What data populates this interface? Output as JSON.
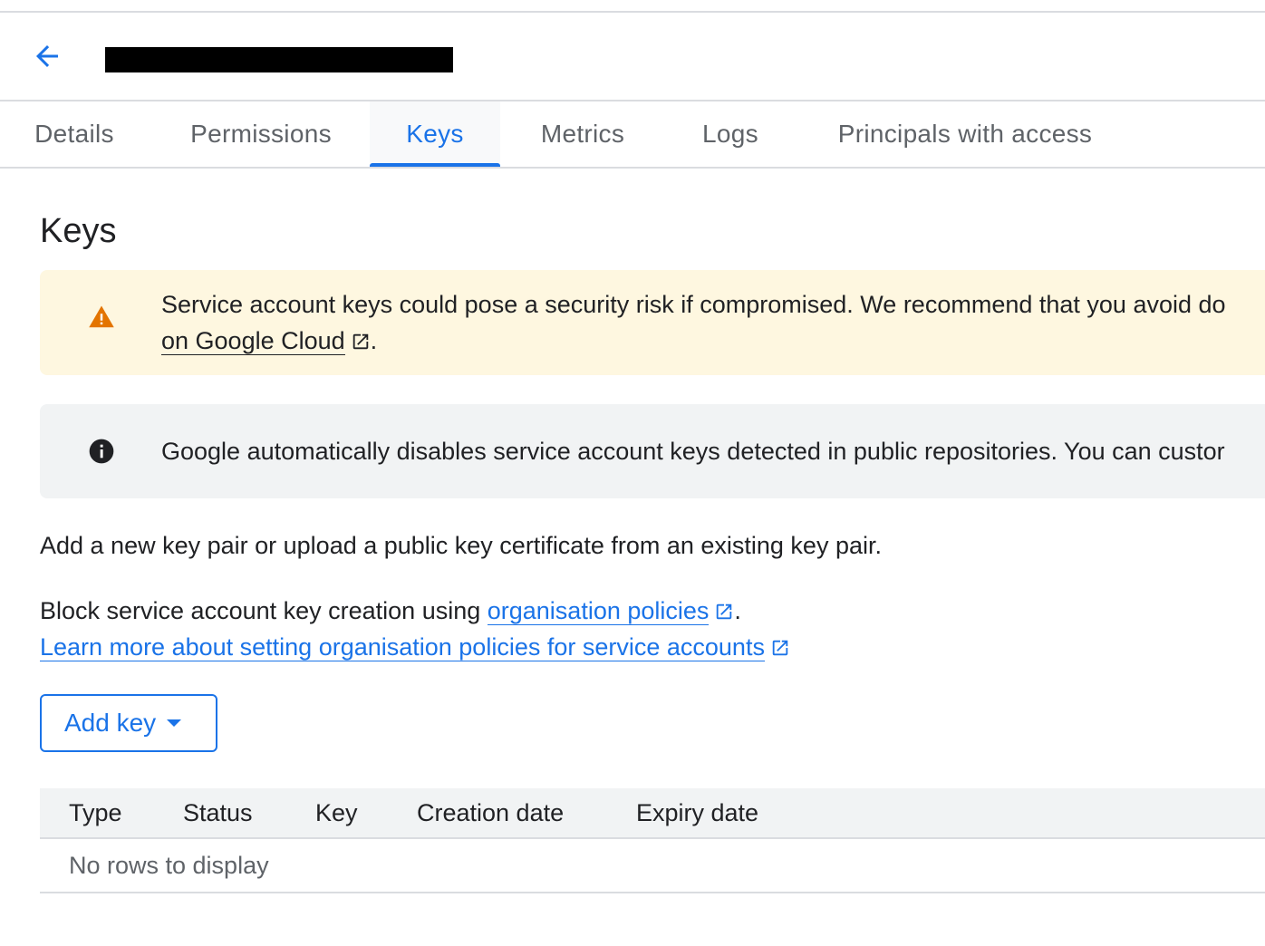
{
  "header": {
    "back_icon": "arrow-back-icon",
    "title_redacted": true
  },
  "tabs": [
    {
      "label": "Details",
      "active": false
    },
    {
      "label": "Permissions",
      "active": false
    },
    {
      "label": "Keys",
      "active": true
    },
    {
      "label": "Metrics",
      "active": false
    },
    {
      "label": "Logs",
      "active": false
    },
    {
      "label": "Principals with access",
      "active": false
    }
  ],
  "page": {
    "title": "Keys"
  },
  "warning_banner": {
    "icon": "warning-icon",
    "line1": "Service account keys could pose a security risk if compromised. We recommend that you avoid do",
    "link_text": "on Google Cloud",
    "link_suffix": "."
  },
  "info_banner": {
    "icon": "info-icon",
    "text": "Google automatically disables service account keys detected in public repositories. You can custor"
  },
  "intro": {
    "text": "Add a new key pair or upload a public key certificate from an existing key pair."
  },
  "policy": {
    "prefix": "Block service account key creation using ",
    "link_text": "organisation policies",
    "suffix": ".",
    "learn_more": "Learn more about setting organisation policies for service accounts"
  },
  "add_key_button": {
    "label": "Add key"
  },
  "table": {
    "columns": [
      "Type",
      "Status",
      "Key",
      "Creation date",
      "Expiry date"
    ],
    "empty_message": "No rows to display"
  },
  "colors": {
    "accent": "#1a73e8",
    "warning_bg": "#fef7e0",
    "warning_icon": "#e37400",
    "info_bg": "#f1f3f4"
  }
}
